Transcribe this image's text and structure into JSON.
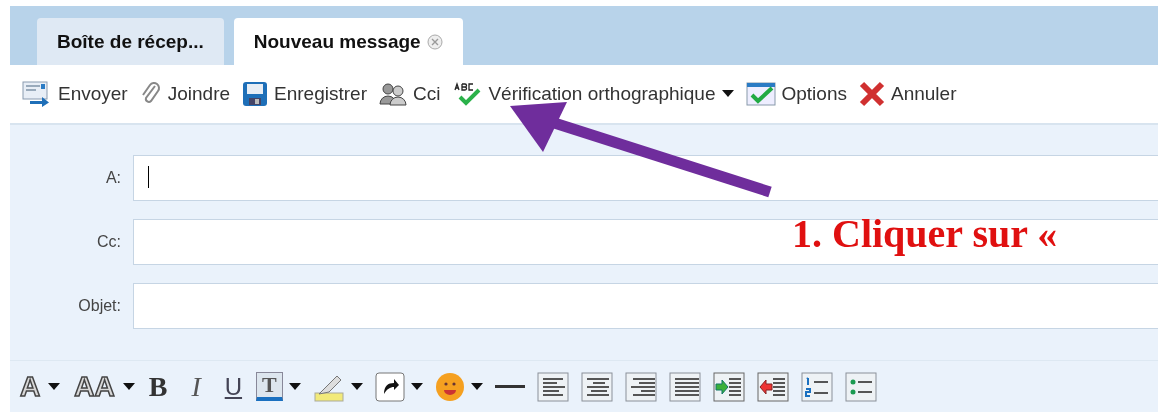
{
  "tabs": [
    {
      "label": "Boîte de récep...",
      "selected": false
    },
    {
      "label": "Nouveau message",
      "selected": true
    }
  ],
  "toolbar": [
    {
      "label": "Envoyer",
      "kind": "button"
    },
    {
      "label": "Joindre",
      "kind": "button"
    },
    {
      "label": "Enregistrer",
      "kind": "button"
    },
    {
      "label": "Cci",
      "kind": "button"
    },
    {
      "label": "Vérification orthographique",
      "kind": "dropdown"
    },
    {
      "label": "Options",
      "kind": "button"
    },
    {
      "label": "Annuler",
      "kind": "button"
    }
  ],
  "fields": [
    {
      "label": "A:",
      "focused": true
    },
    {
      "label": "Cc:",
      "focused": false
    },
    {
      "label": "Objet:",
      "focused": false
    }
  ],
  "format_bar": [
    {
      "kind": "letter",
      "text": "A"
    },
    {
      "kind": "letter",
      "text": "AA"
    },
    {
      "kind": "letter",
      "text": "B"
    },
    {
      "kind": "letter",
      "text": "I"
    },
    {
      "kind": "letter",
      "text": "U"
    },
    {
      "kind": "letter",
      "text": "T"
    },
    {
      "kind": "icon"
    },
    {
      "kind": "icon"
    },
    {
      "kind": "icon"
    },
    {
      "kind": "icon"
    },
    {
      "kind": "icon"
    },
    {
      "kind": "icon"
    },
    {
      "kind": "icon"
    },
    {
      "kind": "icon"
    },
    {
      "kind": "icon"
    },
    {
      "kind": "icon"
    },
    {
      "kind": "icon"
    },
    {
      "kind": "icon"
    }
  ],
  "annotation": {
    "text": "1. Cliquer sur «"
  }
}
